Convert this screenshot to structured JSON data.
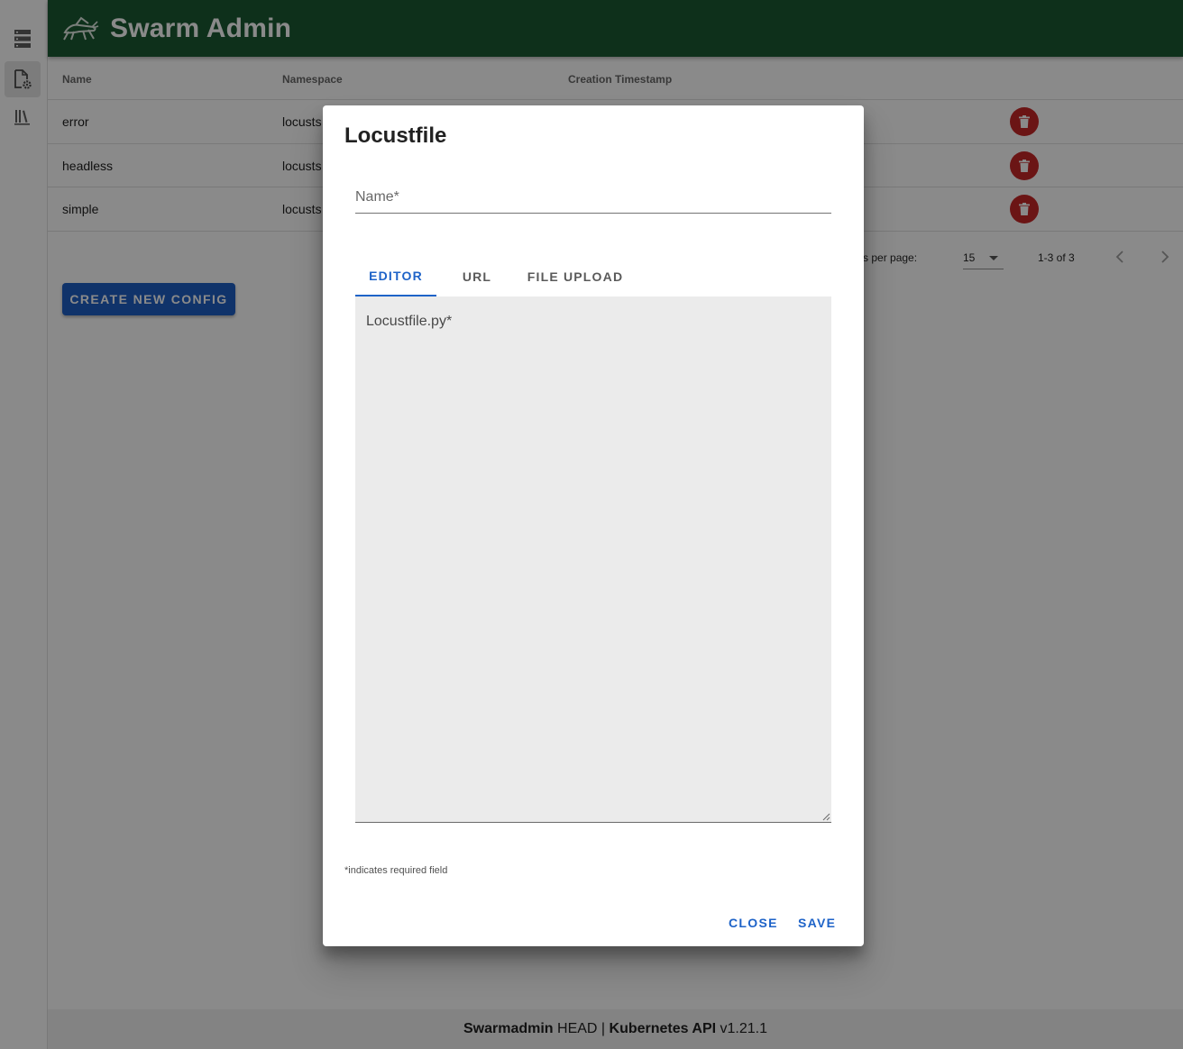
{
  "app": {
    "title": "Swarm Admin",
    "header_color": "#1a5a32"
  },
  "sidebar": {
    "items": [
      {
        "icon": "server-list-icon",
        "active": false
      },
      {
        "icon": "file-settings-icon",
        "active": true
      },
      {
        "icon": "library-icon",
        "active": false
      }
    ]
  },
  "table": {
    "columns": [
      "Name",
      "Namespace",
      "Creation Timestamp"
    ],
    "rows": [
      {
        "name": "error",
        "namespace": "locusts"
      },
      {
        "name": "headless",
        "namespace": "locusts"
      },
      {
        "name": "simple",
        "namespace": "locusts"
      }
    ],
    "pagination": {
      "rows_per_page_label": "Rows per page:",
      "rows_per_page_value": "15",
      "range": "1-3 of 3"
    }
  },
  "actions": {
    "create_label": "CREATE NEW CONFIG"
  },
  "footer": {
    "app_name": "Swarmadmin",
    "app_version": "HEAD",
    "separator": "|",
    "api_name": "Kubernetes API",
    "api_version": "v1.21.1"
  },
  "dialog": {
    "title": "Locustfile",
    "name_label": "Name*",
    "tabs": [
      "EDITOR",
      "URL",
      "FILE UPLOAD"
    ],
    "active_tab": "EDITOR",
    "editor_label": "Locustfile.py*",
    "required_note": "*indicates required field",
    "close_label": "CLOSE",
    "save_label": "SAVE"
  },
  "colors": {
    "primary": "#1e63c8",
    "danger": "#c62828"
  }
}
